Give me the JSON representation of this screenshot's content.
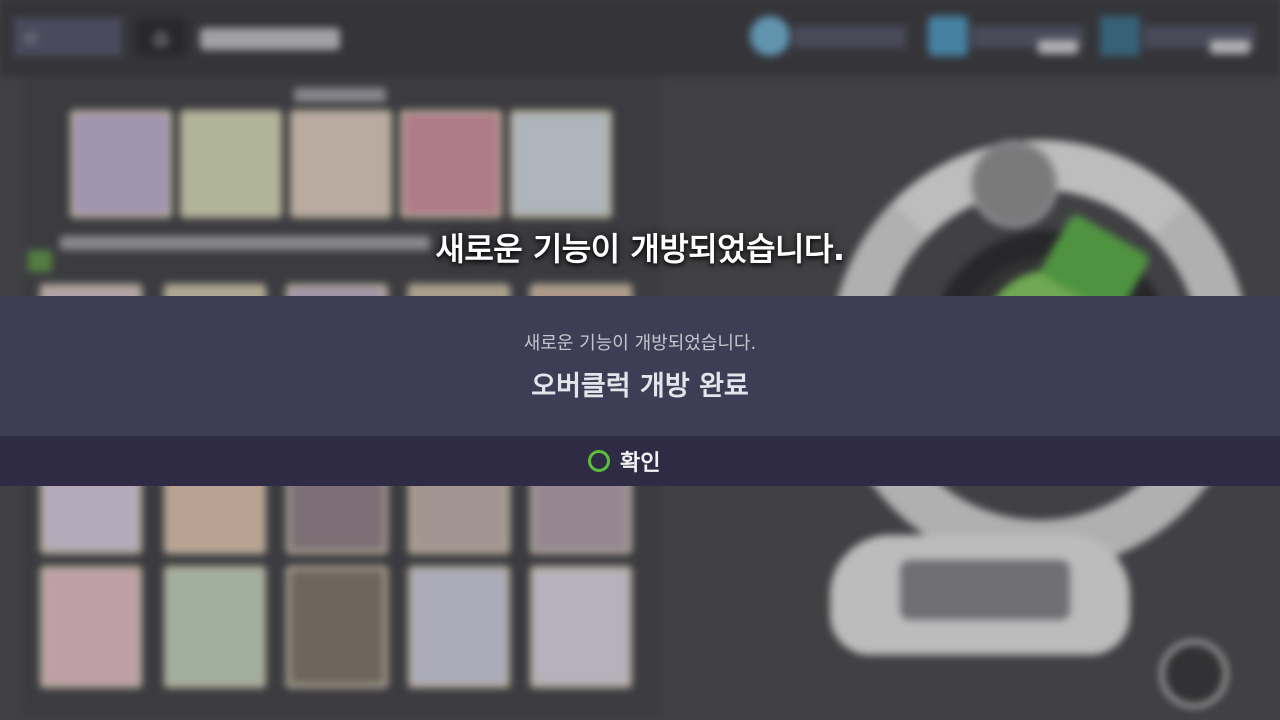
{
  "notice": {
    "headline": "새로운 기능이 개방되었습니다."
  },
  "dialog": {
    "subtitle": "새로운 기능이 개방되었습니다.",
    "title": "오버클럭 개방 완료",
    "confirm_label": "확인",
    "confirm_icon": "circle-icon"
  },
  "colors": {
    "dialog_bg": "#3d3e55",
    "footer_bg": "#2f2b45",
    "confirm_icon": "#5bbf3a"
  }
}
